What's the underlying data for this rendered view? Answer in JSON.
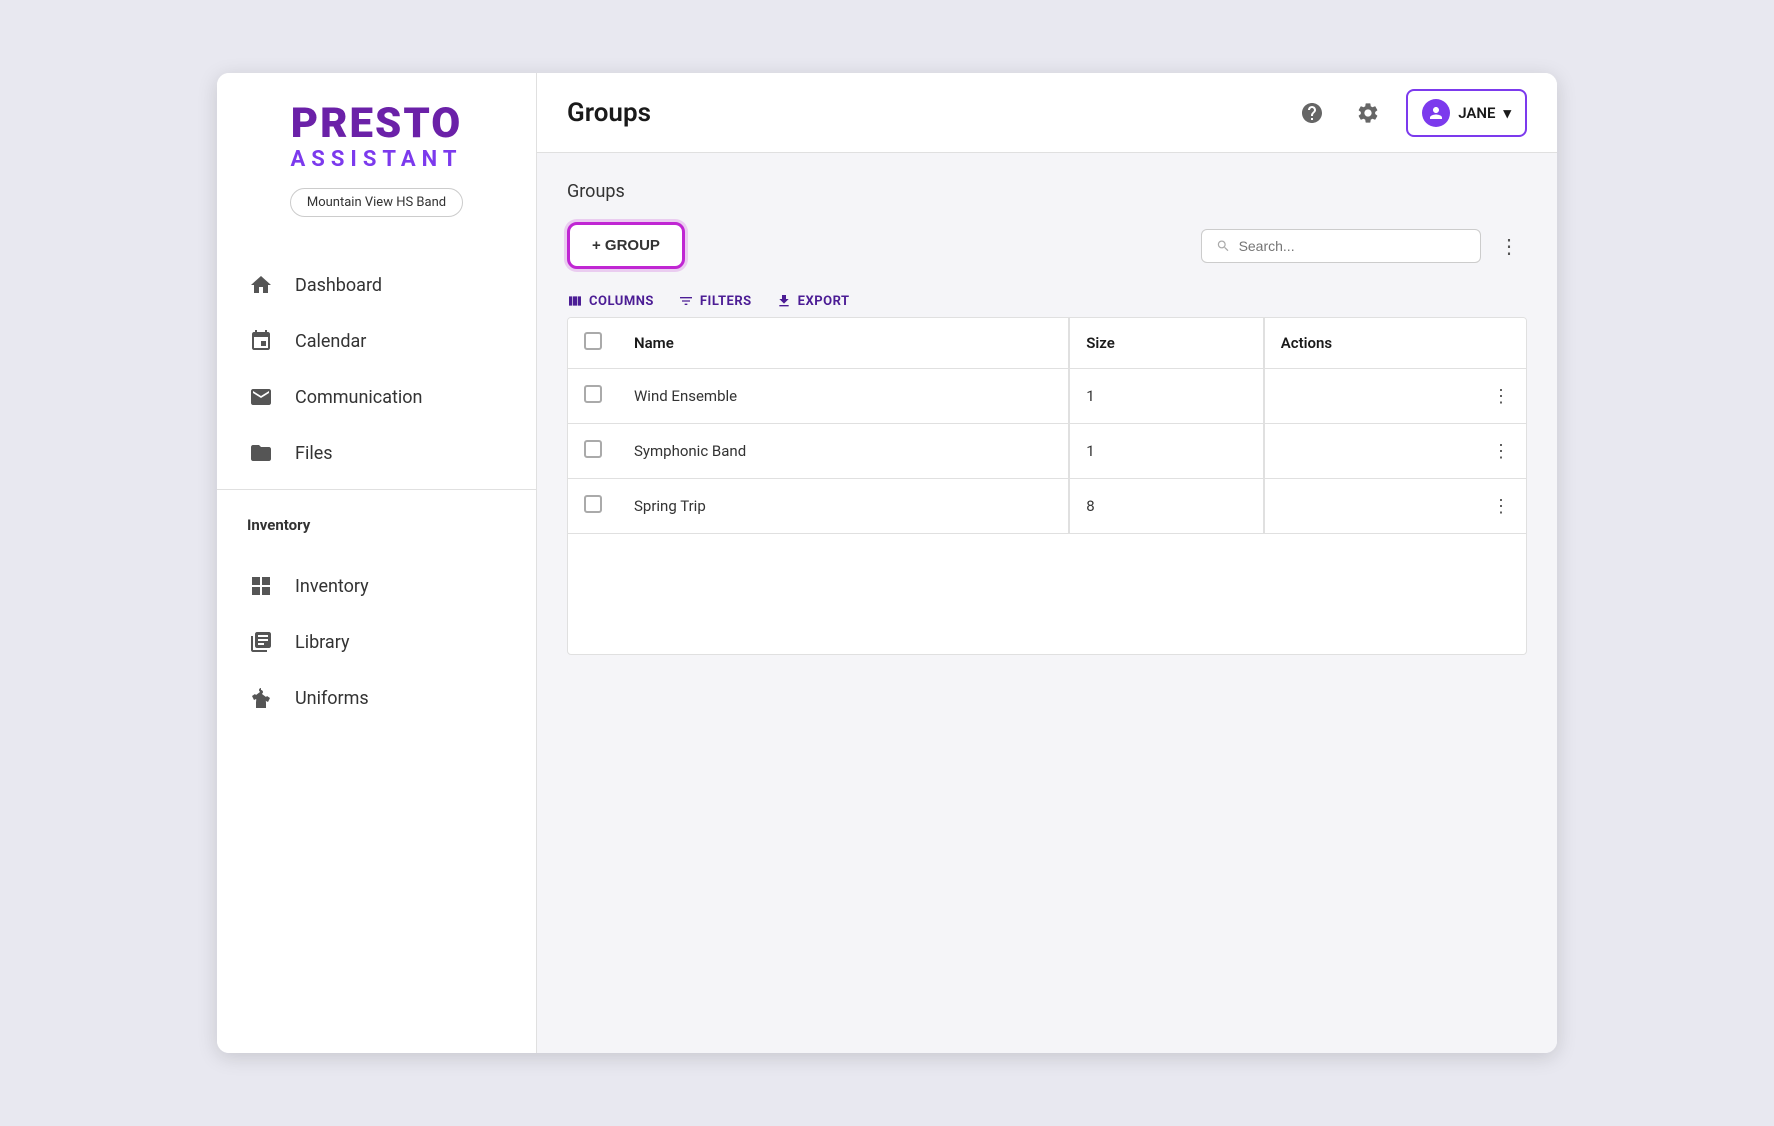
{
  "app": {
    "name": "PRESTO",
    "sub": "ASSISTANT",
    "org": "Mountain View HS Band"
  },
  "sidebar": {
    "nav_items": [
      {
        "id": "dashboard",
        "label": "Dashboard",
        "icon": "home"
      },
      {
        "id": "calendar",
        "label": "Calendar",
        "icon": "calendar"
      },
      {
        "id": "communication",
        "label": "Communication",
        "icon": "mail"
      },
      {
        "id": "files",
        "label": "Files",
        "icon": "folder"
      }
    ],
    "section_label": "Inventory",
    "inventory_items": [
      {
        "id": "inventory",
        "label": "Inventory",
        "icon": "grid"
      },
      {
        "id": "library",
        "label": "Library",
        "icon": "library"
      },
      {
        "id": "uniforms",
        "label": "Uniforms",
        "icon": "uniform"
      }
    ]
  },
  "header": {
    "title": "Groups",
    "user": "JANE"
  },
  "content": {
    "breadcrumb": "Groups",
    "add_group_label": "+ GROUP",
    "columns_label": "COLUMNS",
    "filters_label": "FILTERS",
    "export_label": "EXPORT",
    "search_placeholder": "Search...",
    "table": {
      "columns": [
        "Name",
        "Size",
        "Actions"
      ],
      "rows": [
        {
          "name": "Wind Ensemble",
          "size": "1"
        },
        {
          "name": "Symphonic Band",
          "size": "1"
        },
        {
          "name": "Spring Trip",
          "size": "8"
        }
      ]
    }
  }
}
